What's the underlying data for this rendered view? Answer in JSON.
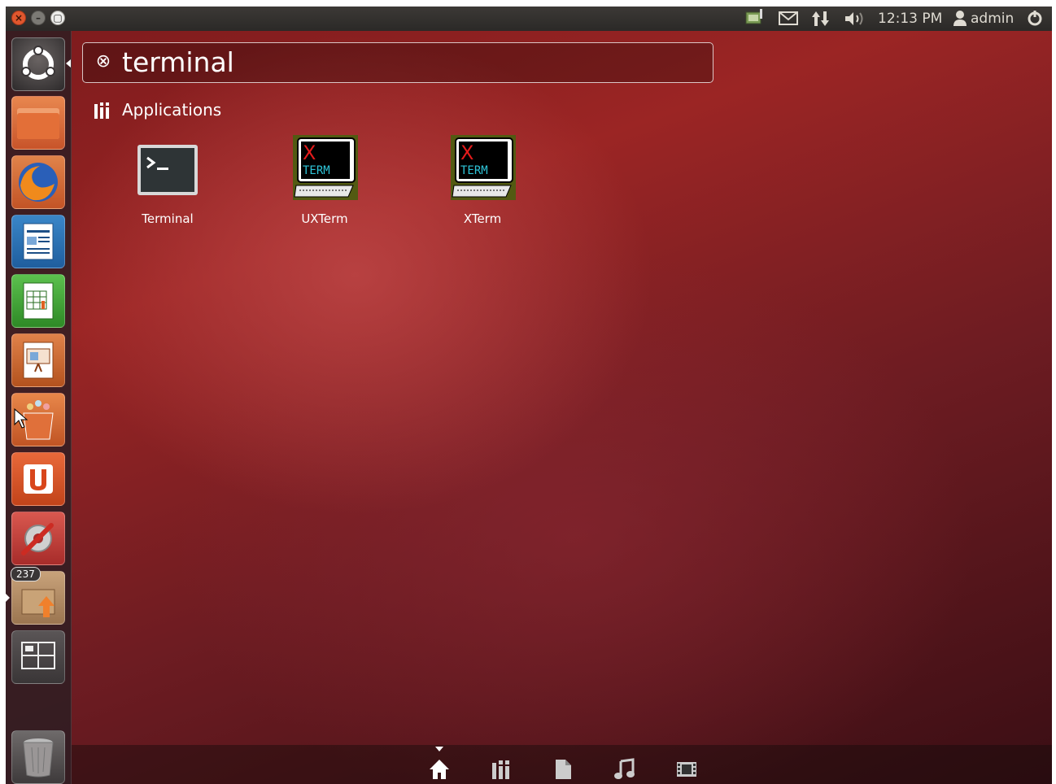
{
  "window_controls": {
    "close": "×",
    "minimize": "–",
    "maximize": "▢"
  },
  "panel": {
    "clock": "12:13 PM",
    "user": "admin"
  },
  "launcher": {
    "items": [
      {
        "name": "dash-home",
        "icon": "ubuntu-logo-icon"
      },
      {
        "name": "files",
        "icon": "folder-icon"
      },
      {
        "name": "firefox",
        "icon": "firefox-icon"
      },
      {
        "name": "writer",
        "icon": "libreoffice-writer-icon"
      },
      {
        "name": "calc",
        "icon": "libreoffice-calc-icon"
      },
      {
        "name": "impress",
        "icon": "libreoffice-impress-icon"
      },
      {
        "name": "software-center",
        "icon": "shopping-bag-icon"
      },
      {
        "name": "ubuntu-one",
        "icon": "ubuntu-one-icon"
      },
      {
        "name": "system-settings",
        "icon": "settings-wrench-icon"
      },
      {
        "name": "update-manager",
        "icon": "update-icon",
        "badge": "237"
      },
      {
        "name": "workspace-switcher",
        "icon": "workspaces-icon"
      },
      {
        "name": "trash",
        "icon": "trash-icon"
      }
    ]
  },
  "search": {
    "query": "terminal"
  },
  "category": {
    "label": "Applications"
  },
  "results": [
    {
      "label": "Terminal",
      "icon": "terminal-icon"
    },
    {
      "label": "UXTerm",
      "icon": "xterm-icon",
      "icon_text_x": "X",
      "icon_text_term": "TERM"
    },
    {
      "label": "XTerm",
      "icon": "xterm-icon",
      "icon_text_x": "X",
      "icon_text_term": "TERM"
    }
  ],
  "lenses": [
    {
      "name": "home",
      "icon": "home-icon",
      "active": true
    },
    {
      "name": "applications",
      "icon": "applications-icon"
    },
    {
      "name": "files",
      "icon": "file-icon"
    },
    {
      "name": "music",
      "icon": "music-note-icon"
    },
    {
      "name": "video",
      "icon": "film-icon"
    }
  ],
  "colors": {
    "accent": "#dd4814",
    "panel": "#2b2927",
    "text": "#ffffff"
  }
}
